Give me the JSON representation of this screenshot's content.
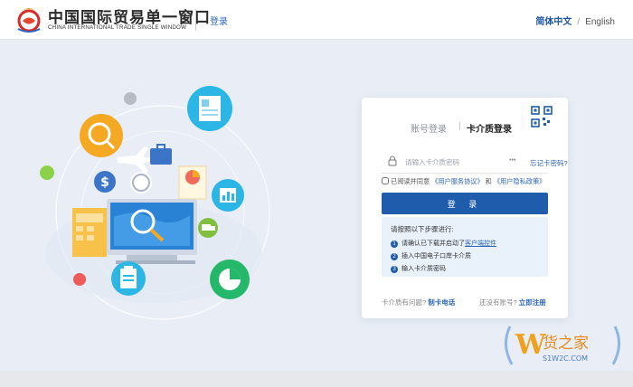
{
  "header": {
    "logo_cn": "中国国际贸易单一窗口",
    "logo_en": "CHINA INTERNATIONAL TRADE SINGLE WINDOW",
    "login_link": "登录",
    "lang_zh": "简体中文",
    "lang_sep": "/",
    "lang_en": "English"
  },
  "login": {
    "tab_account": "账号登录",
    "tab_sep": "|",
    "tab_card": "卡介质登录",
    "password_placeholder": "请输入卡介质密码",
    "forgot": "忘记卡密码?",
    "agree_prefix": "已阅读并同意",
    "agree_link1": "《用户服务协议》",
    "agree_and": "和",
    "agree_link2": "《用户隐私政策》",
    "submit": "登 录",
    "steps_title": "请按照以下步骤进行:",
    "steps": [
      {
        "num": "1",
        "text": "请确认已下载并启动了",
        "link": "客户端控件"
      },
      {
        "num": "2",
        "text": "插入中国电子口岸卡介质",
        "link": ""
      },
      {
        "num": "3",
        "text": "输入卡介质密码",
        "link": ""
      }
    ],
    "foot_q1": "卡介质有问题?",
    "foot_link1": "制卡电话",
    "foot_q2": "还没有账号?",
    "foot_link2": "立即注册"
  },
  "watermark": {
    "brand_w": "W",
    "brand_cn": "货之家",
    "brand_url": "S1W2C.COM"
  },
  "colors": {
    "primary": "#1f5cab",
    "link": "#2c66b8",
    "background": "#e9eef6"
  }
}
